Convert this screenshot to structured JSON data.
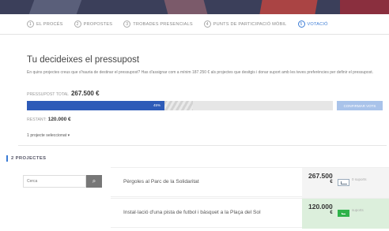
{
  "nav": {
    "items": [
      {
        "num": "1",
        "label": "El procés"
      },
      {
        "num": "2",
        "label": "Propostes"
      },
      {
        "num": "3",
        "label": "Trobades presencials"
      },
      {
        "num": "4",
        "label": "Punts de participació mòbil"
      },
      {
        "num": "5",
        "label": "Votació"
      }
    ],
    "active_index": 4
  },
  "budget": {
    "title": "Tu decideixes el pressupost",
    "description": "En quins projectes creus que s'hauria de destinar el pressupost? Has d'assignar com a mínim 187.250 € als projectes que desitgis i donar suport amb les teves preferències per definir el pressupost.",
    "total_label": "Pressupost total",
    "total_value": "267.500 €",
    "progress_percent": 45,
    "progress_label": "45%",
    "confirm_label": "Confirmar vots",
    "remaining_label": "Restant:",
    "remaining_value": "120.000 €",
    "selected_label": "1 projecte seleccionat ▾"
  },
  "projects_section": {
    "heading": "2 PROJECTES",
    "search_placeholder": "Cerca",
    "items": [
      {
        "name": "Pèrgoles al Parc de la Solidaritat",
        "price": "267.500",
        "currency": "€",
        "supports": "0 suports",
        "selected": false
      },
      {
        "name": "Instal·lació d'una pista de futbol i bàsquet a la Plaça del Sol",
        "price": "120.000",
        "currency": "€",
        "supports": "suports",
        "selected": true
      }
    ]
  },
  "colors": {
    "accent": "#3a7bd5",
    "progress": "#2e5bb8",
    "selected": "#2fb24a"
  }
}
